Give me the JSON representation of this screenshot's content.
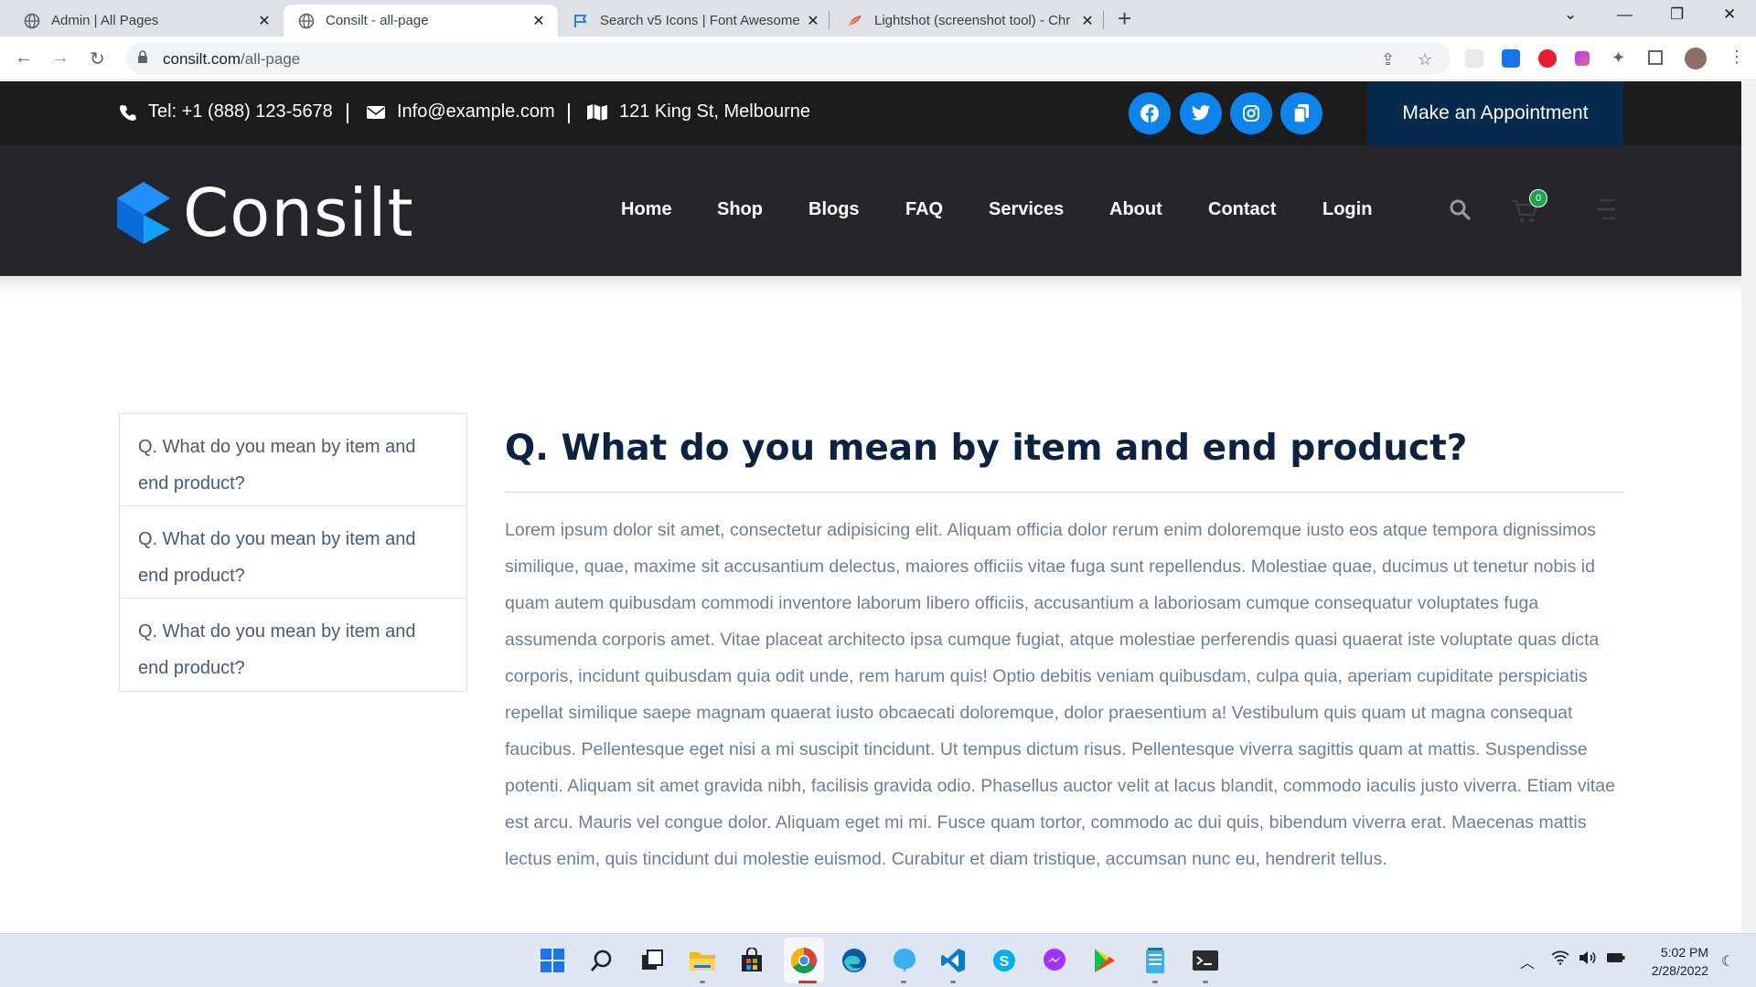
{
  "browser": {
    "tabs": [
      {
        "title": "Admin | All Pages",
        "icon": "globe-icon",
        "active": false
      },
      {
        "title": "Consilt - all-page",
        "icon": "globe-icon",
        "active": true
      },
      {
        "title": "Search v5 Icons | Font Awesome",
        "icon": "flag-icon",
        "active": false
      },
      {
        "title": "Lightshot (screenshot tool) - Chr",
        "icon": "feather-icon",
        "active": false
      }
    ],
    "url_host": "consilt.com",
    "url_path": "/all-page"
  },
  "topbar": {
    "phone": "Tel: +1 (888) 123-5678",
    "email": "Info@example.com",
    "address": "121 King St, Melbourne",
    "appointment_label": "Make an Appointment",
    "social": [
      "facebook-icon",
      "twitter-icon",
      "instagram-icon",
      "copy-icon"
    ]
  },
  "nav": {
    "logo_text": "Consilt",
    "menu": [
      "Home",
      "Shop",
      "Blogs",
      "FAQ",
      "Services",
      "About",
      "Contact",
      "Login"
    ],
    "cart_count": "0"
  },
  "faq": {
    "items": [
      "Q. What do you mean by item and end product?",
      "Q. What do you mean by item and end product?",
      "Q. What do you mean by item and end product?"
    ]
  },
  "article": {
    "title": "Q. What do you mean by item and end product?",
    "body": "Lorem ipsum dolor sit amet, consectetur adipisicing elit. Aliquam officia dolor rerum enim doloremque iusto eos atque tempora dignissimos similique, quae, maxime sit accusantium delectus, maiores officiis vitae fuga sunt repellendus. Molestiae quae, ducimus ut tenetur nobis id quam autem quibusdam commodi inventore laborum libero officiis, accusantium a laboriosam cumque consequatur voluptates fuga assumenda corporis amet. Vitae placeat architecto ipsa cumque fugiat, atque molestiae perferendis quasi quaerat iste voluptate quas dicta corporis, incidunt quibusdam quia odit unde, rem harum quis! Optio debitis veniam quibusdam, culpa quia, aperiam cupiditate perspiciatis repellat similique saepe magnam quaerat iusto obcaecati doloremque, dolor praesentium a! Vestibulum quis quam ut magna consequat faucibus. Pellentesque eget nisi a mi suscipit tincidunt. Ut tempus dictum risus. Pellentesque viverra sagittis quam at mattis. Suspendisse potenti. Aliquam sit amet gravida nibh, facilisis gravida odio. Phasellus auctor velit at lacus blandit, commodo iaculis justo viverra. Etiam vitae est arcu. Mauris vel congue dolor. Aliquam eget mi mi. Fusce quam tortor, commodo ac dui quis, bibendum viverra erat. Maecenas mattis lectus enim, quis tincidunt dui molestie euismod. Curabitur et diam tristique, accumsan nunc eu, hendrerit tellus."
  },
  "taskbar": {
    "time": "5:02 PM",
    "date": "2/28/2022"
  },
  "colors": {
    "accent": "#0b84ee",
    "topbar_bg": "#1b1b1c",
    "nav_bg": "#26262a",
    "appointment_bg": "#062a4d",
    "title_color": "#0b2340",
    "cart_badge": "#18a54b"
  }
}
